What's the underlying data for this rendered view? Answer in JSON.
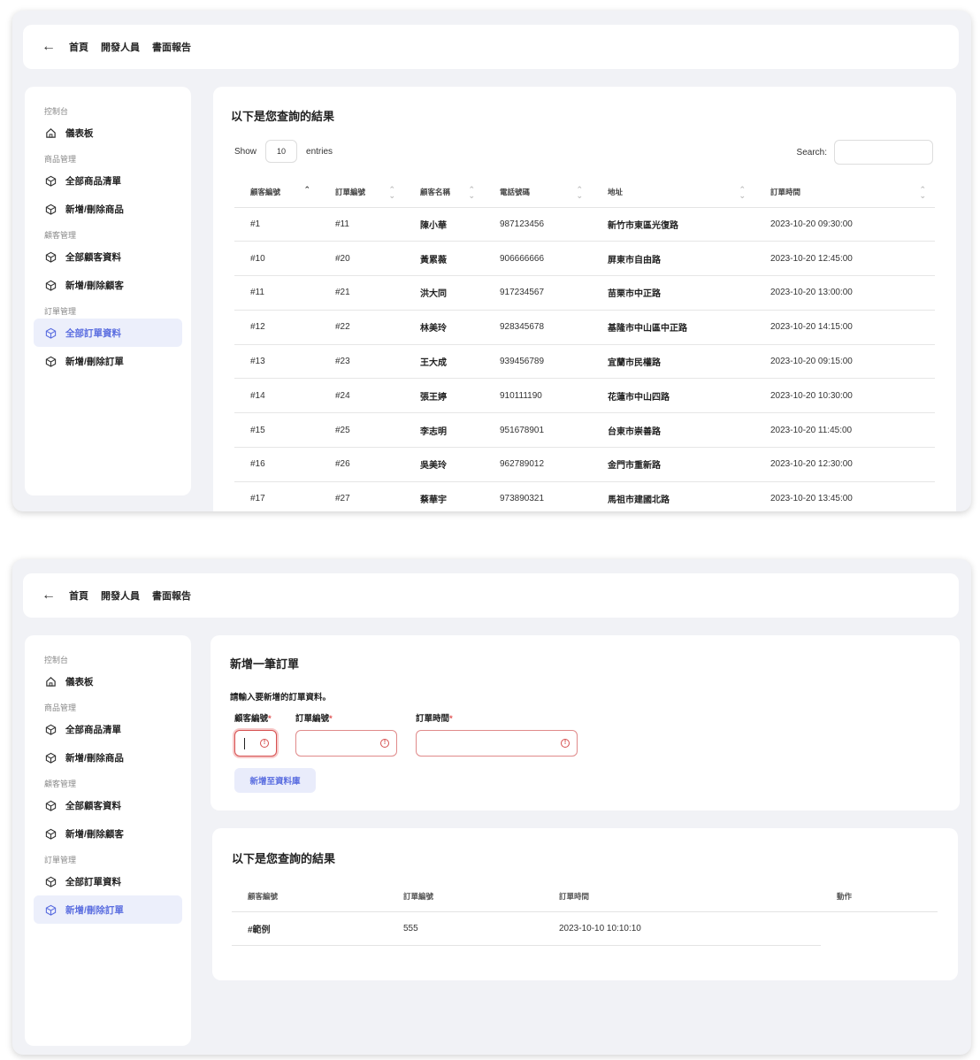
{
  "breadcrumb": {
    "items": [
      "首頁",
      "開發人員",
      "書面報告"
    ]
  },
  "sidebar": {
    "sections": [
      {
        "title": "控制台",
        "items": [
          {
            "label": "儀表板",
            "icon": "home-icon"
          }
        ]
      },
      {
        "title": "商品管理",
        "items": [
          {
            "label": "全部商品清單",
            "icon": "cube-icon"
          },
          {
            "label": "新增/刪除商品",
            "icon": "cube-icon"
          }
        ]
      },
      {
        "title": "顧客管理",
        "items": [
          {
            "label": "全部顧客資料",
            "icon": "cube-icon"
          },
          {
            "label": "新增/刪除顧客",
            "icon": "cube-icon"
          }
        ]
      },
      {
        "title": "訂單管理",
        "items": [
          {
            "label": "全部訂單資料",
            "icon": "cube-icon"
          },
          {
            "label": "新增/刪除訂單",
            "icon": "cube-icon"
          }
        ]
      }
    ]
  },
  "colors": {
    "accent": "#5b6ee0",
    "active_bg": "#eceffb",
    "error": "#d65050",
    "page_bg": "#f1f2f6"
  },
  "window1": {
    "active_item": "全部訂單資料",
    "results_title": "以下是您查詢的結果",
    "show_label": "Show",
    "entries_value": "10",
    "entries_label": "entries",
    "search_label": "Search:",
    "columns": [
      "顧客編號",
      "訂單編號",
      "顧客名稱",
      "電話號碼",
      "地址",
      "訂單時間"
    ],
    "rows": [
      [
        "#1",
        "#11",
        "陳小華",
        "987123456",
        "新竹市東區光復路",
        "2023-10-20 09:30:00"
      ],
      [
        "#10",
        "#20",
        "黃累薇",
        "906666666",
        "屏東市自由路",
        "2023-10-20 12:45:00"
      ],
      [
        "#11",
        "#21",
        "洪大同",
        "917234567",
        "苗栗市中正路",
        "2023-10-20 13:00:00"
      ],
      [
        "#12",
        "#22",
        "林美玲",
        "928345678",
        "基隆市中山區中正路",
        "2023-10-20 14:15:00"
      ],
      [
        "#13",
        "#23",
        "王大成",
        "939456789",
        "宜蘭市民權路",
        "2023-10-20 09:15:00"
      ],
      [
        "#14",
        "#24",
        "張王婷",
        "910111190",
        "花蓮市中山四路",
        "2023-10-20 10:30:00"
      ],
      [
        "#15",
        "#25",
        "李志明",
        "951678901",
        "台東市崇善路",
        "2023-10-20 11:45:00"
      ],
      [
        "#16",
        "#26",
        "吳美玲",
        "962789012",
        "金門市重新路",
        "2023-10-20 12:30:00"
      ],
      [
        "#17",
        "#27",
        "蔡華宇",
        "973890321",
        "馬祖市建國北路",
        "2023-10-20 13:45:00"
      ]
    ]
  },
  "window2": {
    "active_item": "新增/刪除訂單",
    "form_title": "新增一筆訂單",
    "form_prompt": "請輸入要新增的訂單資料。",
    "fields": [
      {
        "label": "顧客編號",
        "required": "*",
        "value": ""
      },
      {
        "label": "訂單編號",
        "required": "*",
        "value": ""
      },
      {
        "label": "訂單時間",
        "required": "*",
        "value": ""
      }
    ],
    "submit_label": "新增至資料庫",
    "results_title": "以下是您查詢的結果",
    "columns": [
      "顧客編號",
      "訂單編號",
      "訂單時間",
      "動作"
    ],
    "rows": [
      [
        "#範例",
        "555",
        "2023-10-10 10:10:10",
        ""
      ]
    ]
  }
}
